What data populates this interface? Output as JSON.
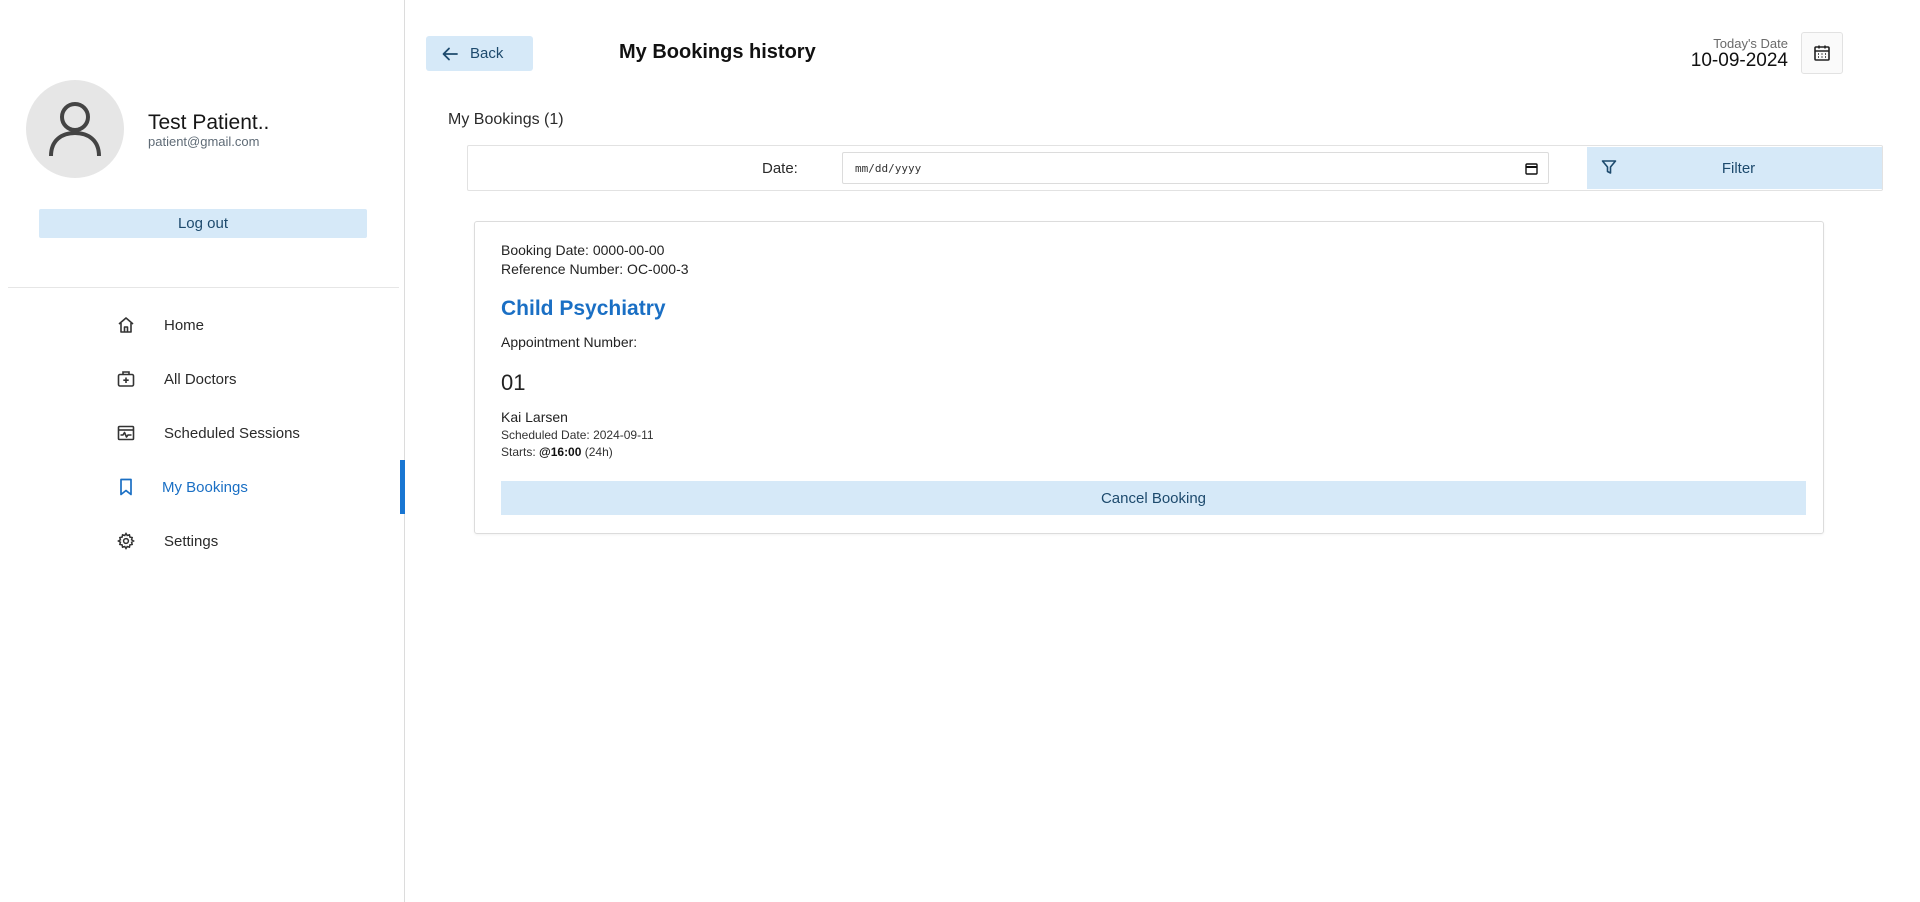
{
  "profile": {
    "name": "Test Patient..",
    "email": "patient@gmail.com",
    "logout_label": "Log out"
  },
  "nav": {
    "items": [
      {
        "label": "Home",
        "icon": "home-icon"
      },
      {
        "label": "All Doctors",
        "icon": "medical-bag-icon"
      },
      {
        "label": "Scheduled Sessions",
        "icon": "schedule-icon"
      },
      {
        "label": "My Bookings",
        "icon": "bookmark-icon",
        "active": true
      },
      {
        "label": "Settings",
        "icon": "gear-icon"
      }
    ]
  },
  "header": {
    "back_label": "Back",
    "title": "My Bookings history",
    "today_label": "Today's Date",
    "today_value": "10-09-2024"
  },
  "bookings": {
    "section_title": "My Bookings (1)",
    "filter": {
      "date_label": "Date:",
      "date_placeholder": "mm/dd/yyyy",
      "button_label": "Filter"
    },
    "card": {
      "booking_date": "Booking Date: 0000-00-00",
      "reference": "Reference Number: OC-000-3",
      "specialty": "Child Psychiatry",
      "appt_label": "Appointment Number:",
      "appt_number": "01",
      "doctor": "Kai Larsen",
      "scheduled": "Scheduled Date: 2024-09-11",
      "starts_prefix": "Starts: ",
      "starts_time": "@16:00",
      "starts_suffix": " (24h)",
      "cancel_label": "Cancel Booking"
    }
  },
  "colors": {
    "accent": "#1976d2",
    "button_bg": "#d6e9f8",
    "button_text": "#1d4a6d"
  }
}
